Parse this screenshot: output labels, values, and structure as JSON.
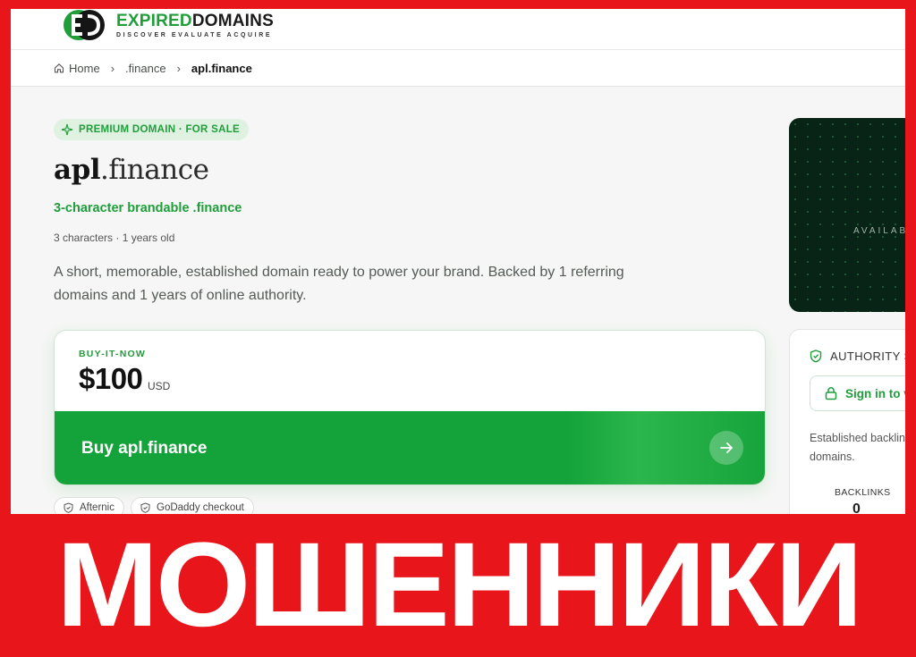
{
  "header": {
    "logo_title_green": "EXPIRED",
    "logo_title_dark": "DOMAINS",
    "logo_subtitle": "DISCOVER EVALUATE ACQUIRE"
  },
  "breadcrumb": {
    "items": [
      "Home",
      ".finance",
      "apl.finance"
    ]
  },
  "listing": {
    "badge": "PREMIUM DOMAIN · FOR SALE",
    "domain_name": "apl",
    "domain_tld": ".finance",
    "tagline": "3-character brandable .finance",
    "meta": "3 characters · 1 years old",
    "description": "A short, memorable, established domain ready to power your brand. Backed by 1 referring domains and 1 years of online authority."
  },
  "purchase": {
    "label": "BUY-IT-NOW",
    "price": "$100",
    "currency": "USD",
    "button_label": "Buy apl.finance",
    "chips": [
      "Afternic",
      "GoDaddy checkout"
    ]
  },
  "sidebar": {
    "dark_panel_text": "AVAILAB",
    "authority_title": "AUTHORITY S",
    "signin_label": "Sign in to v",
    "authority_desc": "Established backlin domains.",
    "metric_label": "BACKLINKS",
    "metric_value": "0"
  },
  "banner": {
    "text": "МОШЕННИКИ"
  },
  "colors": {
    "accent": "#1f9e3a",
    "button": "#13a33a",
    "banner_red": "#e8161b",
    "dark_panel": "#072417"
  },
  "icons": [
    "logo-mark-icon",
    "home-icon",
    "chevron-right-icon",
    "sparkle-icon",
    "arrow-right-icon",
    "shield-icon",
    "lock-icon"
  ]
}
